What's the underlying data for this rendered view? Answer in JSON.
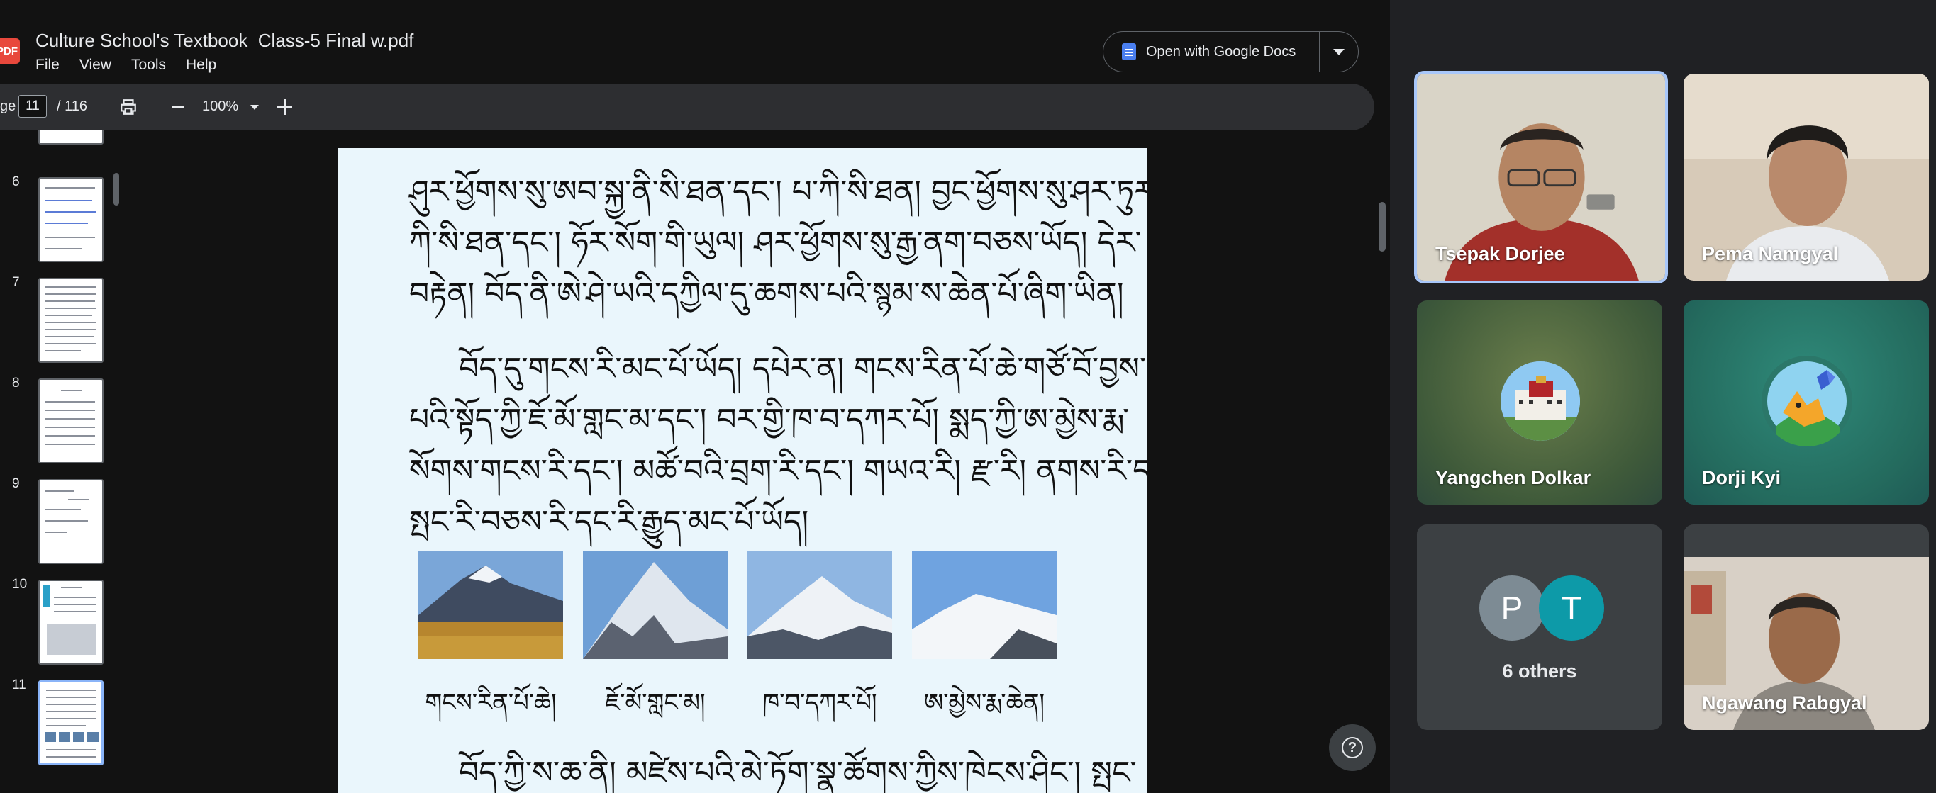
{
  "viewer": {
    "pdf_badge": "PDF",
    "doc_title": "Culture School's Textbook  Class-5 Final w.pdf",
    "menu": [
      "File",
      "View",
      "Tools",
      "Help"
    ],
    "open_with_label": "Open with Google Docs",
    "toolbar": {
      "page_label": "ge",
      "current_page": "11",
      "total_pages": "/  116",
      "zoom": "100%"
    },
    "thumbnails": [
      {
        "num": "6"
      },
      {
        "num": "7"
      },
      {
        "num": "8"
      },
      {
        "num": "9"
      },
      {
        "num": "10"
      },
      {
        "num": "11",
        "active": true
      }
    ],
    "page_lines": [
      "ཤུར་ཕྱོགས་སུ་ཨབ་སྐྱ་ནི་སི་ཐན་དང་། པ་ཀི་སི་ཐན། བྱང་ཕྱོགས་སུ་ཤར་ཏུར་",
      "ཀི་སི་ཐན་དང་། ཧོར་སོག་གི་ཡུལ། ཤར་ཕྱོགས་སུ་རྒྱ་ནག་བཅས་ཡོད། དེར་",
      "བརྟེན། བོད་ནི་ཨེ་ཤེ་ཡའི་དཀྱིལ་དུ་ཆགས་པའི་སྙམ་ས་ཆེན་པོ་ཞིག་ཡིན།",
      "བོད་དུ་གངས་རི་མང་པོ་ཡོད། དཔེར་ན། གངས་རིན་པོ་ཆེ་གཙོ་བོ་བྱས་",
      "པའི་སྟོད་ཀྱི་ཇོ་མོ་གླང་མ་དང་། བར་གྱི་ཁ་བ་དཀར་པོ། སྨད་ཀྱི་ཨ་མྱེས་རྨ་",
      "སོགས་གངས་རི་དང་། མཚོ་བའི་བྲག་རི་དང་། གཡའ་རི། རྫ་རི། ནགས་རི་དང་",
      "སྤང་རི་བཅས་རི་དང་རི་རྒྱུད་མང་པོ་ཡོད།"
    ],
    "captions": [
      "གངས་རིན་པོ་ཆེ།",
      "ཇོ་མོ་གླང་མ།",
      "ཁ་བ་དཀར་པོ།",
      "ཨ་མྱེས་རྨ་ཆེན།"
    ],
    "last_line": "བོད་ཀྱི་ས་ཆ་ནི། མཛེས་པའི་མེ་ཏོག་སྣ་ཚོགས་ཀྱིས་ཁེངས་ཤིང་། སྤང་"
  },
  "participants": [
    {
      "name": "Tsepak Dorjee",
      "type": "video",
      "speaking": true
    },
    {
      "name": "Pema Namgyal",
      "type": "video"
    },
    {
      "name": "Yangchen Dolkar",
      "type": "avatar"
    },
    {
      "name": "Dorji Kyi",
      "type": "avatar"
    },
    {
      "name": "6 others",
      "type": "group",
      "letters": [
        "P",
        "T"
      ]
    },
    {
      "name": "Ngawang Rabgyal",
      "type": "video"
    }
  ],
  "colors": {
    "tile_green": "#4f6a3e",
    "tile_teal": "#2f7a6e",
    "tile_gray": "#3c4043",
    "avatar_p": "#7d8b94",
    "avatar_t": "#0d9aa8",
    "speaking_border": "#a8c7fa"
  }
}
